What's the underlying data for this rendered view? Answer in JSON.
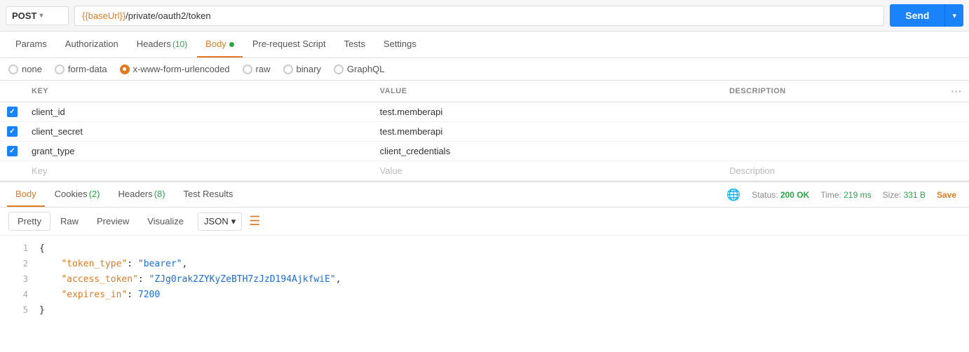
{
  "method": {
    "value": "POST",
    "arrow": "▾"
  },
  "url": {
    "template": "{{baseUrl}}",
    "path": "/private/oauth2/token"
  },
  "send_btn": {
    "label": "Send",
    "arrow": "▾"
  },
  "request_tabs": [
    {
      "id": "params",
      "label": "Params",
      "active": false
    },
    {
      "id": "authorization",
      "label": "Authorization",
      "active": false
    },
    {
      "id": "headers",
      "label": "Headers",
      "badge": "(10)",
      "active": false
    },
    {
      "id": "body",
      "label": "Body",
      "dot": true,
      "active": true
    },
    {
      "id": "pre-request",
      "label": "Pre-request Script",
      "active": false
    },
    {
      "id": "tests",
      "label": "Tests",
      "active": false
    },
    {
      "id": "settings",
      "label": "Settings",
      "active": false
    }
  ],
  "body_types": [
    {
      "id": "none",
      "label": "none",
      "selected": false
    },
    {
      "id": "form-data",
      "label": "form-data",
      "selected": false
    },
    {
      "id": "x-www-form-urlencoded",
      "label": "x-www-form-urlencoded",
      "selected": true
    },
    {
      "id": "raw",
      "label": "raw",
      "selected": false
    },
    {
      "id": "binary",
      "label": "binary",
      "selected": false
    },
    {
      "id": "graphql",
      "label": "GraphQL",
      "selected": false
    }
  ],
  "table": {
    "columns": [
      "KEY",
      "VALUE",
      "DESCRIPTION"
    ],
    "rows": [
      {
        "checked": true,
        "key": "client_id",
        "value": "test.memberapi",
        "description": ""
      },
      {
        "checked": true,
        "key": "client_secret",
        "value": "test.memberapi",
        "description": ""
      },
      {
        "checked": true,
        "key": "grant_type",
        "value": "client_credentials",
        "description": ""
      }
    ],
    "placeholder_row": {
      "key": "Key",
      "value": "Value",
      "description": "Description"
    }
  },
  "response": {
    "tabs": [
      {
        "id": "body",
        "label": "Body",
        "active": true
      },
      {
        "id": "cookies",
        "label": "Cookies",
        "badge": "(2)",
        "active": false
      },
      {
        "id": "headers",
        "label": "Headers",
        "badge": "(8)",
        "active": false
      },
      {
        "id": "test-results",
        "label": "Test Results",
        "active": false
      }
    ],
    "status": {
      "label": "Status:",
      "value": "200 OK"
    },
    "time": {
      "label": "Time:",
      "value": "219 ms"
    },
    "size": {
      "label": "Size:",
      "value": "331 B"
    },
    "save_label": "Save"
  },
  "format_tabs": [
    {
      "id": "pretty",
      "label": "Pretty",
      "active": true
    },
    {
      "id": "raw",
      "label": "Raw",
      "active": false
    },
    {
      "id": "preview",
      "label": "Preview",
      "active": false
    },
    {
      "id": "visualize",
      "label": "Visualize",
      "active": false
    }
  ],
  "format_select": {
    "value": "JSON",
    "arrow": "▾"
  },
  "json_response": {
    "lines": [
      {
        "num": 1,
        "content": "{",
        "type": "brace"
      },
      {
        "num": 2,
        "key": "token_type",
        "value": "\"bearer\"",
        "value_type": "string"
      },
      {
        "num": 3,
        "key": "access_token",
        "value": "\"ZJg0rak2ZYKyZeBTH7zJzD194AjkfwiE\"",
        "value_type": "string"
      },
      {
        "num": 4,
        "key": "expires_in",
        "value": "7200",
        "value_type": "number"
      },
      {
        "num": 5,
        "content": "}",
        "type": "brace"
      }
    ]
  }
}
